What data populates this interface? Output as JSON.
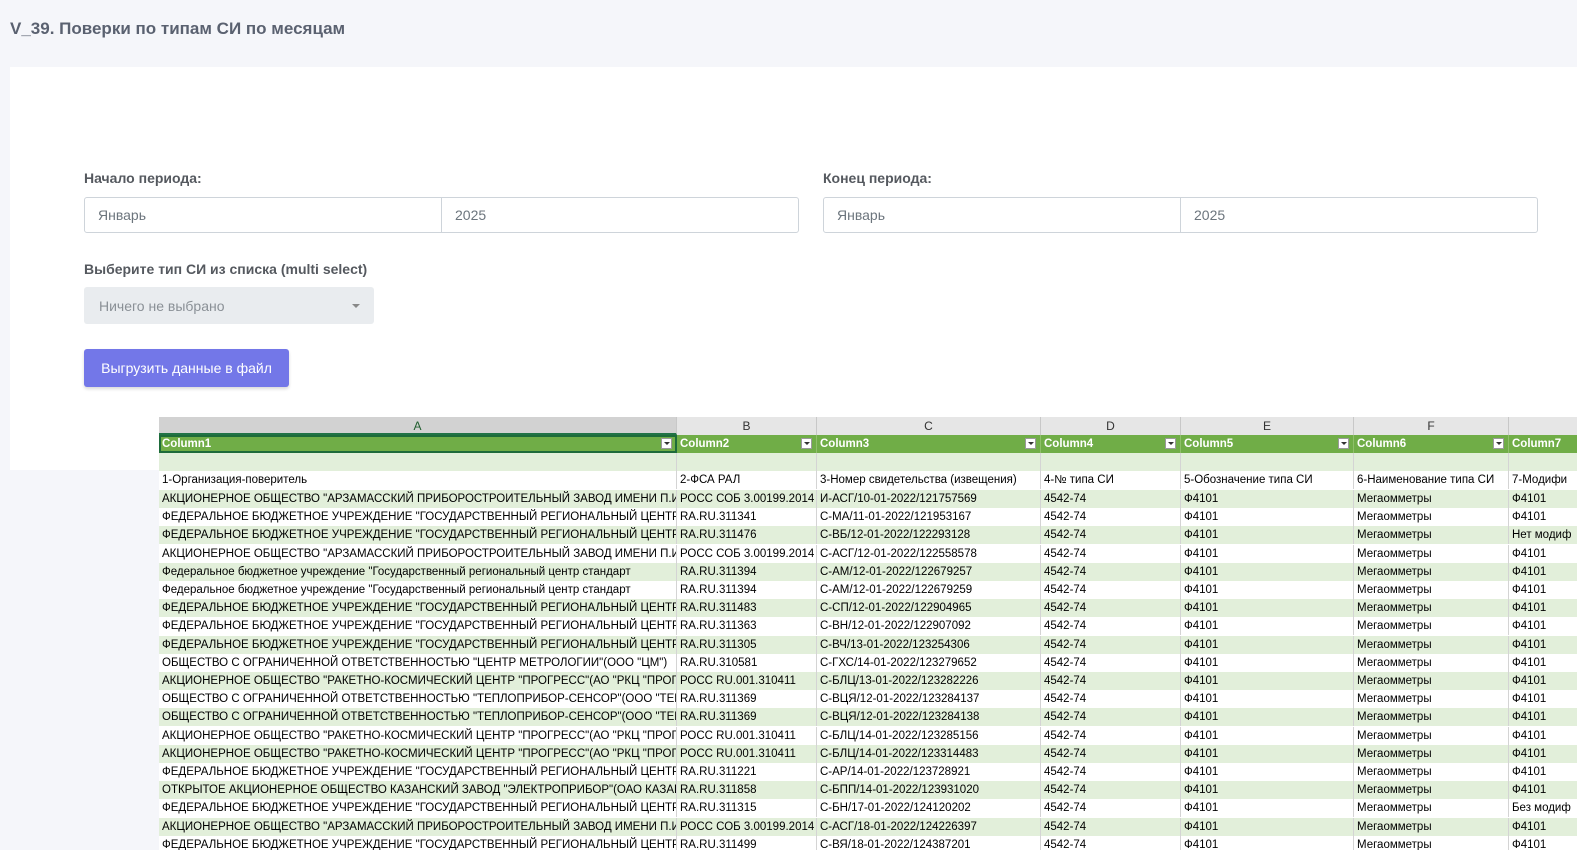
{
  "page": {
    "title": "V_39. Поверки по типам СИ по месяцам"
  },
  "form": {
    "start_label": "Начало периода:",
    "start_month": "Январь",
    "start_year": "2025",
    "end_label": "Конец периода:",
    "end_month": "Январь",
    "end_year": "2025",
    "type_label": "Выберите тип СИ из списка (multi select)",
    "type_placeholder": "Ничего не выбрано",
    "export_button": "Выгрузить данные в файл"
  },
  "sheet": {
    "letters": [
      "A",
      "B",
      "C",
      "D",
      "E",
      "F"
    ],
    "columns": [
      "Column1",
      "Column2",
      "Column3",
      "Column4",
      "Column5",
      "Column6",
      "Column7"
    ],
    "field_names": [
      "1-Организация-поверитель",
      "2-ФСА РАЛ",
      "3-Номер свидетельства (извещения)",
      "4-№ типа СИ",
      "5-Обозначение типа СИ",
      "6-Наименование типа СИ",
      "7-Модифи"
    ],
    "rows": [
      [
        "АКЦИОНЕРНОЕ ОБЩЕСТВО \"АРЗАМАССКИЙ ПРИБОРОСТРОИТЕЛЬНЫЙ ЗАВОД ИМЕНИ П.И",
        "РОСС СОБ 3.00199.2014",
        "И-АСГ/10-01-2022/121757569",
        "4542-74",
        "Ф4101",
        "Мегаомметры",
        "Ф4101"
      ],
      [
        "ФЕДЕРАЛЬНОЕ БЮДЖЕТНОЕ УЧРЕЖДЕНИЕ \"ГОСУДАРСТВЕННЫЙ РЕГИОНАЛЬНЫЙ ЦЕНТР С",
        "RA.RU.311341",
        "С-МА/11-01-2022/121953167",
        "4542-74",
        "Ф4101",
        "Мегаомметры",
        "Ф4101"
      ],
      [
        "ФЕДЕРАЛЬНОЕ БЮДЖЕТНОЕ УЧРЕЖДЕНИЕ \"ГОСУДАРСТВЕННЫЙ РЕГИОНАЛЬНЫЙ ЦЕНТР С",
        "RA.RU.311476",
        "С-ВБ/12-01-2022/122293128",
        "4542-74",
        "Ф4101",
        "Мегаомметры",
        "Нет модиф"
      ],
      [
        "АКЦИОНЕРНОЕ ОБЩЕСТВО \"АРЗАМАССКИЙ ПРИБОРОСТРОИТЕЛЬНЫЙ ЗАВОД ИМЕНИ П.И",
        "РОСС СОБ 3.00199.2014",
        "С-АСГ/12-01-2022/122558578",
        "4542-74",
        "Ф4101",
        "Мегаомметры",
        "Ф4101"
      ],
      [
        "Федеральное бюджетное учреждение \"Государственный региональный центр стандарт",
        "RA.RU.311394",
        "С-АМ/12-01-2022/122679257",
        "4542-74",
        "Ф4101",
        "Мегаомметры",
        "Ф4101"
      ],
      [
        "Федеральное бюджетное учреждение \"Государственный региональный центр стандарт",
        "RA.RU.311394",
        "С-АМ/12-01-2022/122679259",
        "4542-74",
        "Ф4101",
        "Мегаомметры",
        "Ф4101"
      ],
      [
        "ФЕДЕРАЛЬНОЕ БЮДЖЕТНОЕ УЧРЕЖДЕНИЕ \"ГОСУДАРСТВЕННЫЙ РЕГИОНАЛЬНЫЙ ЦЕНТР С",
        "RA.RU.311483",
        "С-СП/12-01-2022/122904965",
        "4542-74",
        "Ф4101",
        "Мегаомметры",
        "Ф4101"
      ],
      [
        "ФЕДЕРАЛЬНОЕ БЮДЖЕТНОЕ УЧРЕЖДЕНИЕ \"ГОСУДАРСТВЕННЫЙ РЕГИОНАЛЬНЫЙ ЦЕНТР С",
        "RA.RU.311363",
        "С-ВН/12-01-2022/122907092",
        "4542-74",
        "Ф4101",
        "Мегаомметры",
        "Ф4101"
      ],
      [
        "ФЕДЕРАЛЬНОЕ БЮДЖЕТНОЕ УЧРЕЖДЕНИЕ \"ГОСУДАРСТВЕННЫЙ РЕГИОНАЛЬНЫЙ ЦЕНТР С",
        "RA.RU.311305",
        "С-ВЧ/13-01-2022/123254306",
        "4542-74",
        "Ф4101",
        "Мегаомметры",
        "Ф4101"
      ],
      [
        "ОБЩЕСТВО С ОГРАНИЧЕННОЙ ОТВЕТСТВЕННОСТЬЮ \"ЦЕНТР МЕТРОЛОГИИ\"(ООО \"ЦМ\")",
        "RA.RU.310581",
        "С-ГХС/14-01-2022/123279652",
        "4542-74",
        "Ф4101",
        "Мегаомметры",
        "Ф4101"
      ],
      [
        "АКЦИОНЕРНОЕ ОБЩЕСТВО \"РАКЕТНО-КОСМИЧЕСКИЙ ЦЕНТР \"ПРОГРЕСС\"(АО \"РКЦ \"ПРОГ",
        "РОСС RU.001.310411",
        "С-БЛЦ/13-01-2022/123282226",
        "4542-74",
        "Ф4101",
        "Мегаомметры",
        "Ф4101"
      ],
      [
        "ОБЩЕСТВО С ОГРАНИЧЕННОЙ ОТВЕТСТВЕННОСТЬЮ \"ТЕПЛОПРИБОР-СЕНСОР\"(ООО \"ТЕПЛ",
        "RA.RU.311369",
        "С-ВЦЯ/12-01-2022/123284137",
        "4542-74",
        "Ф4101",
        "Мегаомметры",
        "Ф4101"
      ],
      [
        "ОБЩЕСТВО С ОГРАНИЧЕННОЙ ОТВЕТСТВЕННОСТЬЮ \"ТЕПЛОПРИБОР-СЕНСОР\"(ООО \"ТЕПЛ",
        "RA.RU.311369",
        "С-ВЦЯ/12-01-2022/123284138",
        "4542-74",
        "Ф4101",
        "Мегаомметры",
        "Ф4101"
      ],
      [
        "АКЦИОНЕРНОЕ ОБЩЕСТВО \"РАКЕТНО-КОСМИЧЕСКИЙ ЦЕНТР \"ПРОГРЕСС\"(АО \"РКЦ \"ПРОГ",
        "РОСС RU.001.310411",
        "С-БЛЦ/14-01-2022/123285156",
        "4542-74",
        "Ф4101",
        "Мегаомметры",
        "Ф4101"
      ],
      [
        "АКЦИОНЕРНОЕ ОБЩЕСТВО \"РАКЕТНО-КОСМИЧЕСКИЙ ЦЕНТР \"ПРОГРЕСС\"(АО \"РКЦ \"ПРОГ",
        "РОСС RU.001.310411",
        "С-БЛЦ/14-01-2022/123314483",
        "4542-74",
        "Ф4101",
        "Мегаомметры",
        "Ф4101"
      ],
      [
        "ФЕДЕРАЛЬНОЕ БЮДЖЕТНОЕ УЧРЕЖДЕНИЕ \"ГОСУДАРСТВЕННЫЙ РЕГИОНАЛЬНЫЙ ЦЕНТР С",
        "RA.RU.311221",
        "С-АР/14-01-2022/123728921",
        "4542-74",
        "Ф4101",
        "Мегаомметры",
        "Ф4101"
      ],
      [
        "ОТКРЫТОЕ АКЦИОНЕРНОЕ ОБЩЕСТВО КАЗАНСКИЙ ЗАВОД \"ЭЛЕКТРОПРИБОР\"(ОАО КАЗАН",
        "RA.RU.311858",
        "С-БПП/14-01-2022/123931020",
        "4542-74",
        "Ф4101",
        "Мегаомметры",
        "Ф4101"
      ],
      [
        "ФЕДЕРАЛЬНОЕ БЮДЖЕТНОЕ  УЧРЕЖДЕНИЕ \"ГОСУДАРСТВЕННЫЙ РЕГИОНАЛЬНЫЙ ЦЕНТР",
        "RA.RU.311315",
        "С-БН/17-01-2022/124120202",
        "4542-74",
        "Ф4101",
        "Мегаомметры",
        "Без модиф"
      ],
      [
        "АКЦИОНЕРНОЕ ОБЩЕСТВО \"АРЗАМАССКИЙ ПРИБОРОСТРОИТЕЛЬНЫЙ ЗАВОД ИМЕНИ П.И",
        "РОСС СОБ 3.00199.2014",
        "С-АСГ/18-01-2022/124226397",
        "4542-74",
        "Ф4101",
        "Мегаомметры",
        "Ф4101"
      ],
      [
        "ФЕДЕРАЛЬНОЕ БЮДЖЕТНОЕ УЧРЕЖДЕНИЕ \"ГОСУДАРСТВЕННЫЙ РЕГИОНАЛЬНЫЙ ЦЕНТР С",
        "RA.RU.311499",
        "С-ВЯ/18-01-2022/124387201",
        "4542-74",
        "Ф4101",
        "Мегаомметры",
        "Ф4101"
      ]
    ]
  },
  "colors": {
    "accent_button": "#7377e8",
    "table_header": "#70ad47",
    "table_band": "#e2efda"
  }
}
